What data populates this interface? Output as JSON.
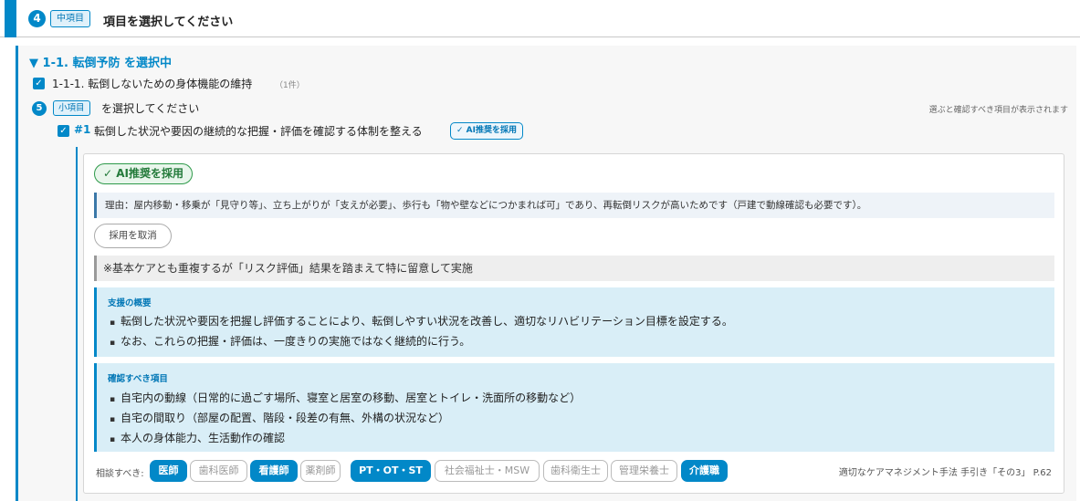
{
  "step4": {
    "number": "4",
    "tag": "中項目",
    "title": "項目を選択してください"
  },
  "section": {
    "title": "▼ 1-1. 転倒予防 を選択中"
  },
  "item111": {
    "label": "1-1-1. 転倒しないための身体機能の維持",
    "count": "（1件）"
  },
  "step5": {
    "number": "5",
    "tag": "小項目",
    "title": "を選択してください",
    "hint": "選ぶと確認すべき項目が表示されます"
  },
  "item1": {
    "num": "#1",
    "label": "転倒した状況や要因の継続的な把握・評価を確認する体制を整える",
    "ai_chip": "✓ AI推奨を採用"
  },
  "card": {
    "ai_badge": "✓ AI推奨を採用",
    "reason": "理由：屋内移動・移乗が「見守り等」、立ち上がりが「支えが必要」、歩行も「物や壁などにつかまれば可」であり、再転倒リスクが高いためです（戸建で動線確認も必要です）。",
    "cancel_label": "採用を取消",
    "note": "※基本ケアとも重複するが「リスク評価」結果を踏まえて特に留意して実施",
    "summary": {
      "heading": "支援の概要",
      "items": [
        "転倒した状況や要因を把握し評価することにより、転倒しやすい状況を改善し、適切なリハビリテーション目標を設定する。",
        "なお、これらの把握・評価は、一度きりの実施ではなく継続的に行う。"
      ]
    },
    "check": {
      "heading": "確認すべき項目",
      "items": [
        "自宅内の動線（日常的に過ごす場所、寝室と居室の移動、居室とトイレ・洗面所の移動など）",
        "自宅の間取り（部屋の配置、階段・段差の有無、外構の状況など）",
        "本人の身体能力、生活動作の確認"
      ]
    },
    "consult_label": "相談すべき:",
    "consult": [
      {
        "label": "医師",
        "on": true
      },
      {
        "label": "歯科医師",
        "on": false
      },
      {
        "label": "看護師",
        "on": true
      },
      {
        "label": "薬剤師",
        "on": false
      },
      {
        "label": "PT・OT・ST",
        "on": true
      },
      {
        "label": "社会福祉士・MSW",
        "on": false
      },
      {
        "label": "歯科衛生士",
        "on": false
      },
      {
        "label": "管理栄養士",
        "on": false
      },
      {
        "label": "介護職",
        "on": true
      }
    ],
    "reference": "適切なケアマネジメント手法 手引き「その3」 P.62"
  },
  "colors": {
    "accent": "#0288c8",
    "ai_green": "#2e9a4a"
  },
  "icons": {
    "checkbox": "check-icon"
  }
}
